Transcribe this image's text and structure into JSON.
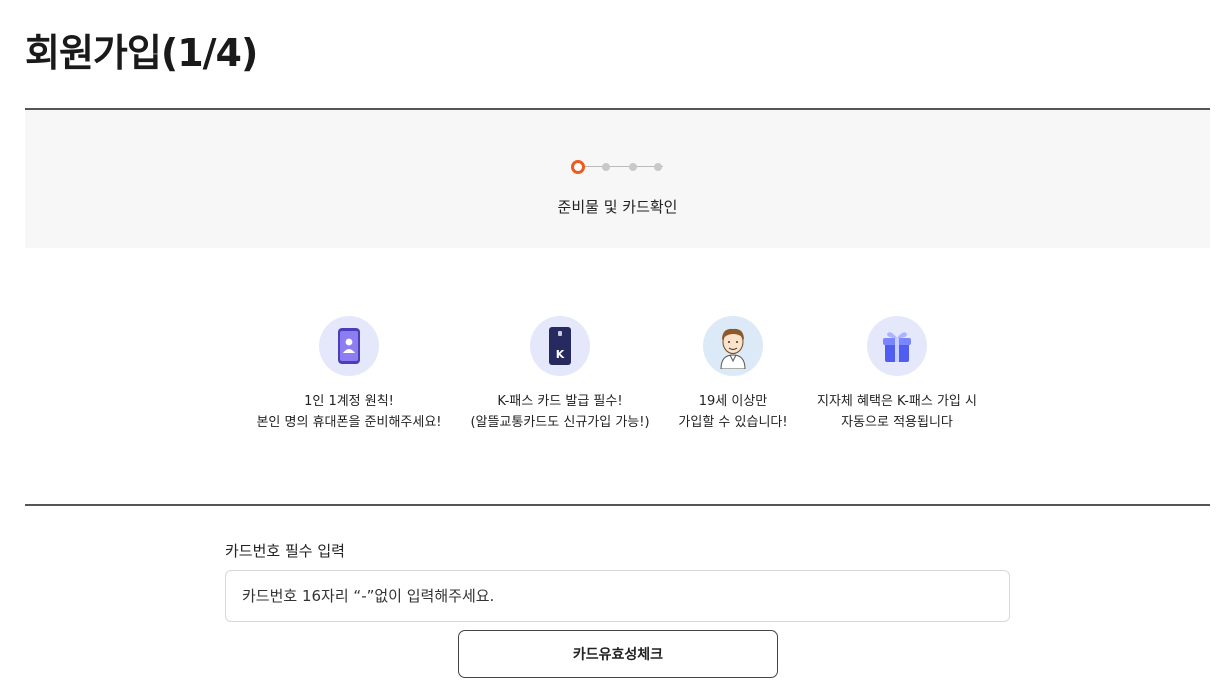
{
  "header": {
    "title": "회원가입(1/4)"
  },
  "stepper": {
    "current_step": 1,
    "total_steps": 4,
    "current_label": "준비물 및 카드확인",
    "active_color": "#ee5a1f"
  },
  "requirements": [
    {
      "icon": "phone-user-icon",
      "line1": "1인 1계정 원칙!",
      "line2": "본인 명의 휴대폰을 준비해주세요!"
    },
    {
      "icon": "transit-card-icon",
      "line1": "K-패스 카드 발급 필수!",
      "line2": "(알뜰교통카드도 신규가입 가능!)"
    },
    {
      "icon": "person-avatar-icon",
      "line1": "19세 이상만",
      "line2": "가입할 수 있습니다!"
    },
    {
      "icon": "gift-box-icon",
      "line1": "지자체 혜택은 K-패스 가입 시",
      "line2": "자동으로 적용됩니다"
    }
  ],
  "card_form": {
    "label": "카드번호 필수 입력",
    "input_value": "",
    "input_placeholder": "카드번호 16자리 “-”없이 입력해주세요.",
    "check_button_label": "카드유효성체크"
  }
}
